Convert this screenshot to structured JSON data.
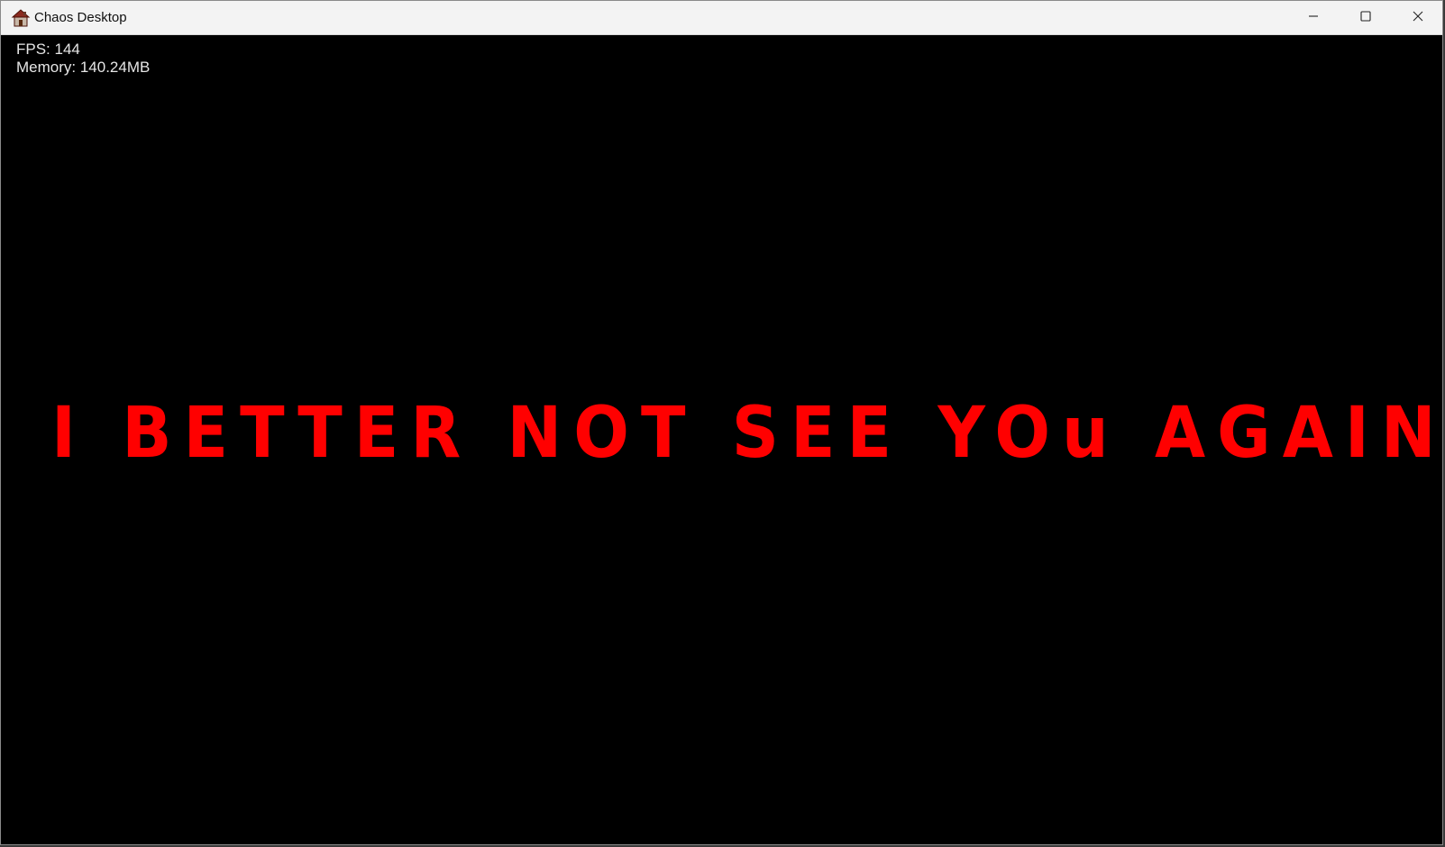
{
  "window": {
    "title": "Chaos Desktop",
    "app_icon": "house-icon",
    "controls": {
      "minimize": "minimize-icon",
      "maximize": "maximize-icon",
      "close": "close-icon"
    }
  },
  "overlay": {
    "fps": "FPS: 144",
    "memory": "Memory: 140.24MB"
  },
  "main": {
    "message": "I BETTER NOT SEE YOu AGAIN",
    "message_color": "#ff0000",
    "background_color": "#000000"
  }
}
